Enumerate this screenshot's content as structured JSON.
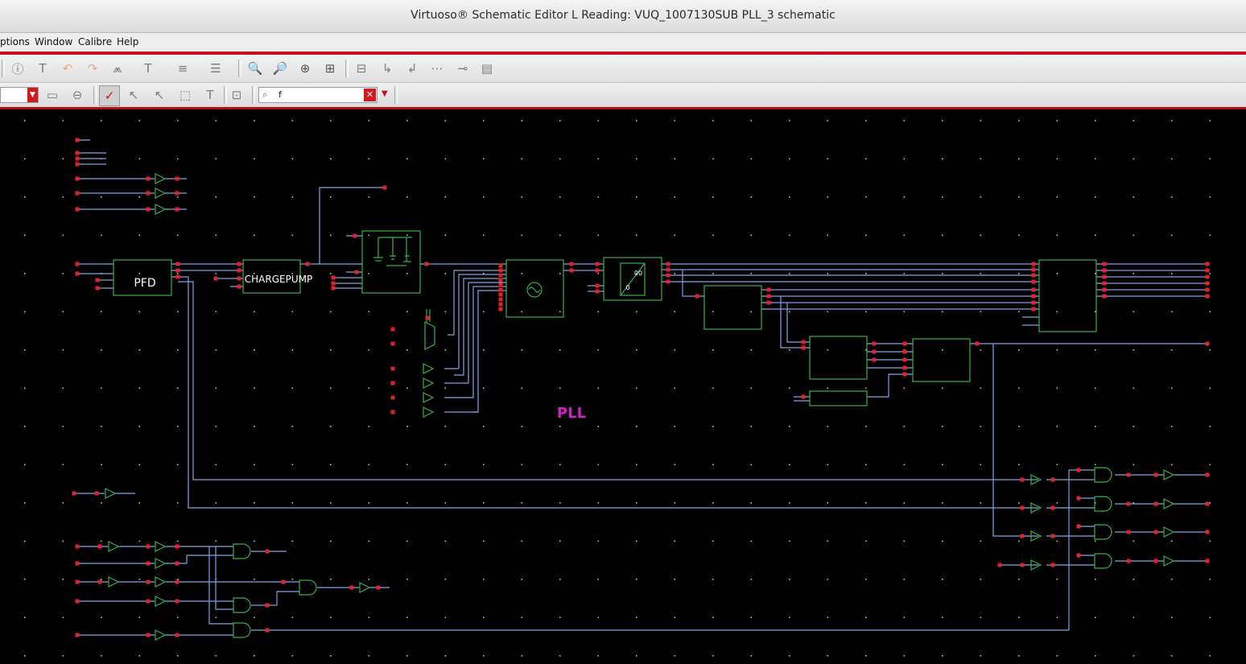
{
  "window": {
    "title": "Virtuoso® Schematic Editor L Reading: VUQ_1007130SUB PLL_3 schematic"
  },
  "menu": {
    "items": [
      "ptions",
      "Window",
      "Calibre",
      "Help"
    ]
  },
  "toolbar": {
    "icons": [
      "info-icon",
      "edit-properties-icon",
      "undo-icon",
      "redo-icon",
      "stretch-icon",
      "text-icon",
      "align-icon",
      "distribute-icon",
      "zoom-in-icon",
      "zoom-out-icon",
      "zoom-area-icon",
      "fit-icon",
      "hierarchy-icon",
      "descend-icon",
      "ascend-icon",
      "bus-icon",
      "pin-icon",
      "netlist-icon"
    ]
  },
  "toolbar2": {
    "icons": [
      "save-view-icon",
      "discard-view-icon",
      "select-all-icon",
      "select-instance-icon",
      "select-pointer-icon",
      "select-area-icon",
      "select-text-icon",
      "properties-icon"
    ],
    "search_value": "f"
  },
  "schematic": {
    "title_label": "PLL",
    "blocks": {
      "pfd": "PFD",
      "chargepump": "CHARGEPUMP",
      "divider_top": "00",
      "divider_bottom": "0"
    }
  },
  "colors": {
    "wire": "#7fa6e8",
    "symbol": "#37b24a",
    "pin": "#e0222a",
    "label": "#d31fc8",
    "accent": "#c8101a"
  }
}
